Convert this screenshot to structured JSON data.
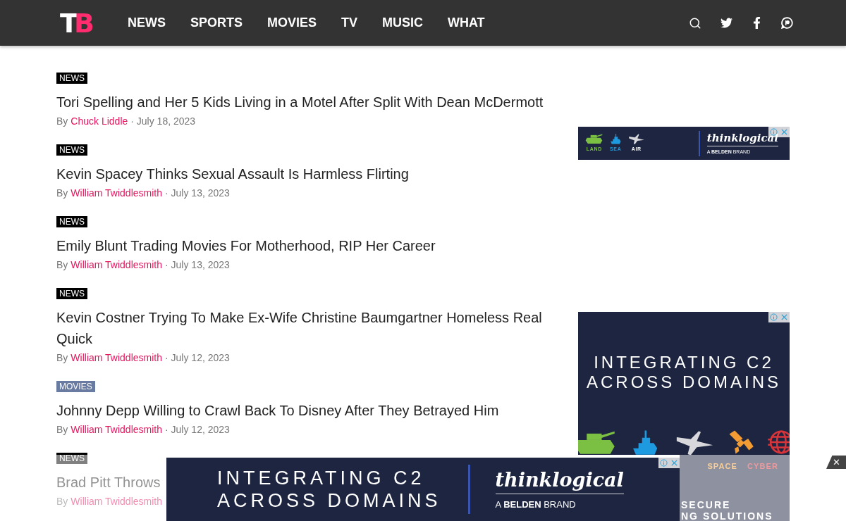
{
  "header": {
    "logo": {
      "letters": [
        "T",
        "B"
      ]
    },
    "nav": [
      {
        "label": "NEWS"
      },
      {
        "label": "SPORTS"
      },
      {
        "label": "MOVIES"
      },
      {
        "label": "TV"
      },
      {
        "label": "MUSIC"
      },
      {
        "label": "WHAT"
      }
    ],
    "icons": [
      {
        "kind": "search"
      },
      {
        "kind": "twitter"
      },
      {
        "kind": "facebook"
      },
      {
        "kind": "patreon"
      }
    ]
  },
  "articles": [
    {
      "category": "NEWS",
      "color": "#000000",
      "title": "Tori Spelling and Her 5 Kids Living in a Motel After Split With Dean McDermott",
      "by": "By",
      "author": "Chuck Liddle",
      "date": "· July 18, 2023"
    },
    {
      "category": "NEWS",
      "color": "#000000",
      "title": "Kevin Spacey Thinks Sexual Assault Is Harmless Flirting",
      "by": "By",
      "author": "William Twiddlesmith",
      "date": "· July 13, 2023"
    },
    {
      "category": "NEWS",
      "color": "#000000",
      "title": "Emily Blunt Trading Movies For Motherhood, RIP Her Career",
      "by": "By",
      "author": "William Twiddlesmith",
      "date": "· July 13, 2023"
    },
    {
      "category": "NEWS",
      "color": "#000000",
      "title": "Kevin Costner Trying To Make Ex-Wife Christine Baumgartner Homeless Real Quick",
      "by": "By",
      "author": "William Twiddlesmith",
      "date": "· July 12, 2023"
    },
    {
      "category": "MOVIES",
      "color": "#6a7ba2",
      "title": "Johnny Depp Willing to Crawl Back To Disney After They Betrayed Him",
      "by": "By",
      "author": "William Twiddlesmith",
      "date": "· July 12, 2023"
    },
    {
      "category": "NEWS",
      "title": "Brad Pitt Throws",
      "by": "By",
      "author": "William Twiddlesmith"
    }
  ],
  "side_ads": [
    {
      "kind": "banner",
      "icons": [
        {
          "kind": "tank",
          "label": "LAND",
          "color": "#7bc043"
        },
        {
          "kind": "ship",
          "label": "SEA",
          "color": "#1e9be0"
        },
        {
          "kind": "jet",
          "label": "AIR",
          "color": "#ffffff"
        }
      ],
      "brand": "thinklogical",
      "tagline": "A **BELDEN** BRAND"
    },
    {
      "kind": "tall",
      "headline": [
        "INTEGRATING C2",
        "ACROSS DOMAINS"
      ],
      "icons": [
        {
          "kind": "tank"
        },
        {
          "kind": "ship"
        },
        {
          "kind": "jet"
        },
        {
          "kind": "satellite",
          "label": "SPACE"
        },
        {
          "kind": "globe",
          "label": "CYBER"
        }
      ],
      "footer": [
        "SECURE",
        "NG SOLUTIONS"
      ]
    }
  ],
  "sticky_ad": {
    "headline": [
      "INTEGRATING C2",
      "ACROSS DOMAINS"
    ],
    "brand": "thinklogical",
    "tagline": "A **BELDEN** BRAND",
    "close": "✕"
  }
}
